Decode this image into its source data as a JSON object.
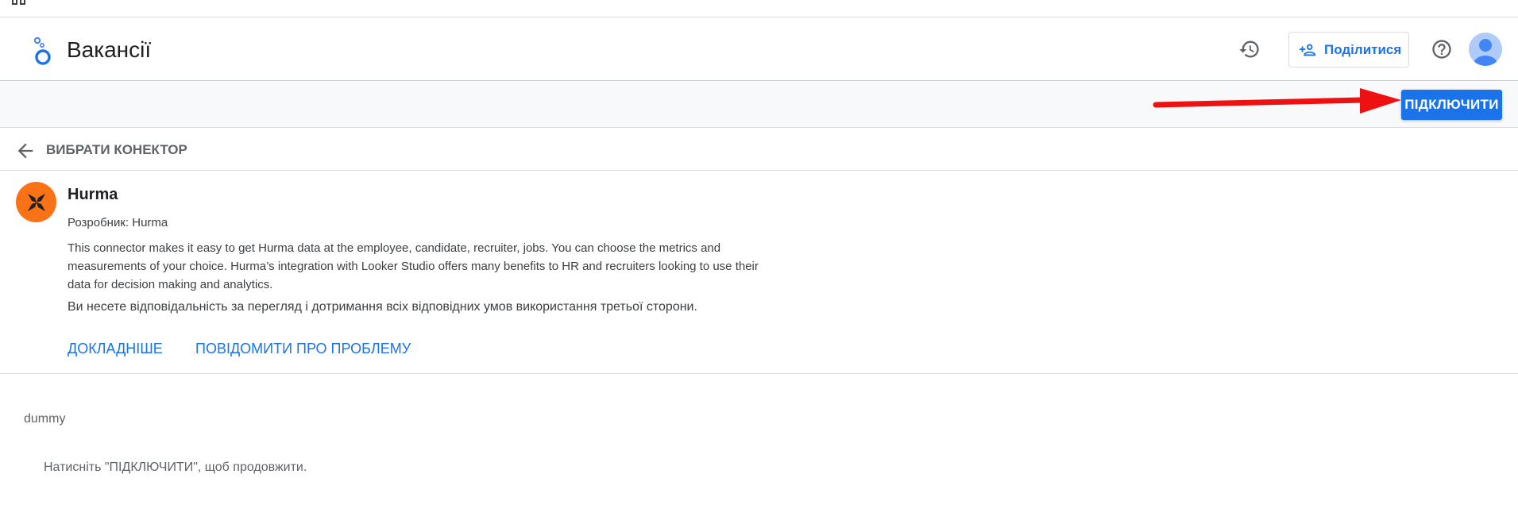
{
  "header": {
    "title": "Вакансії",
    "share_label": "Поділитися",
    "icons": [
      "history-icon",
      "person-add-icon",
      "help-icon",
      "avatar"
    ]
  },
  "toolbar": {
    "connect_label": "ПІДКЛЮЧИТИ"
  },
  "back": {
    "label": "ВИБРАТИ КОНЕКТОР"
  },
  "connector": {
    "name": "Hurma",
    "developer": "Розробник: Hurma",
    "description": "This connector makes it easy to get Hurma data at the employee, candidate, recruiter, jobs. You can choose the metrics and measurements of your choice. Hurma’s integration with Looker Studio offers many benefits to HR and recruiters looking to use their data for decision making and analytics.",
    "responsibility": "Ви несете відповідальність за перегляд і дотримання всіх відповідних умов використання третьої сторони.",
    "learn_more": "ДОКЛАДНІШЕ",
    "report_issue": "ПОВІДОМИТИ ПРО ПРОБЛЕМУ",
    "brand_color": "#f97316"
  },
  "body": {
    "dummy_label": "dummy",
    "hint": "Натисніть \"ПІДКЛЮЧИТИ\", щоб продовжити."
  },
  "colors": {
    "accent": "#1a73e8",
    "annotation_arrow": "#ee1111"
  }
}
